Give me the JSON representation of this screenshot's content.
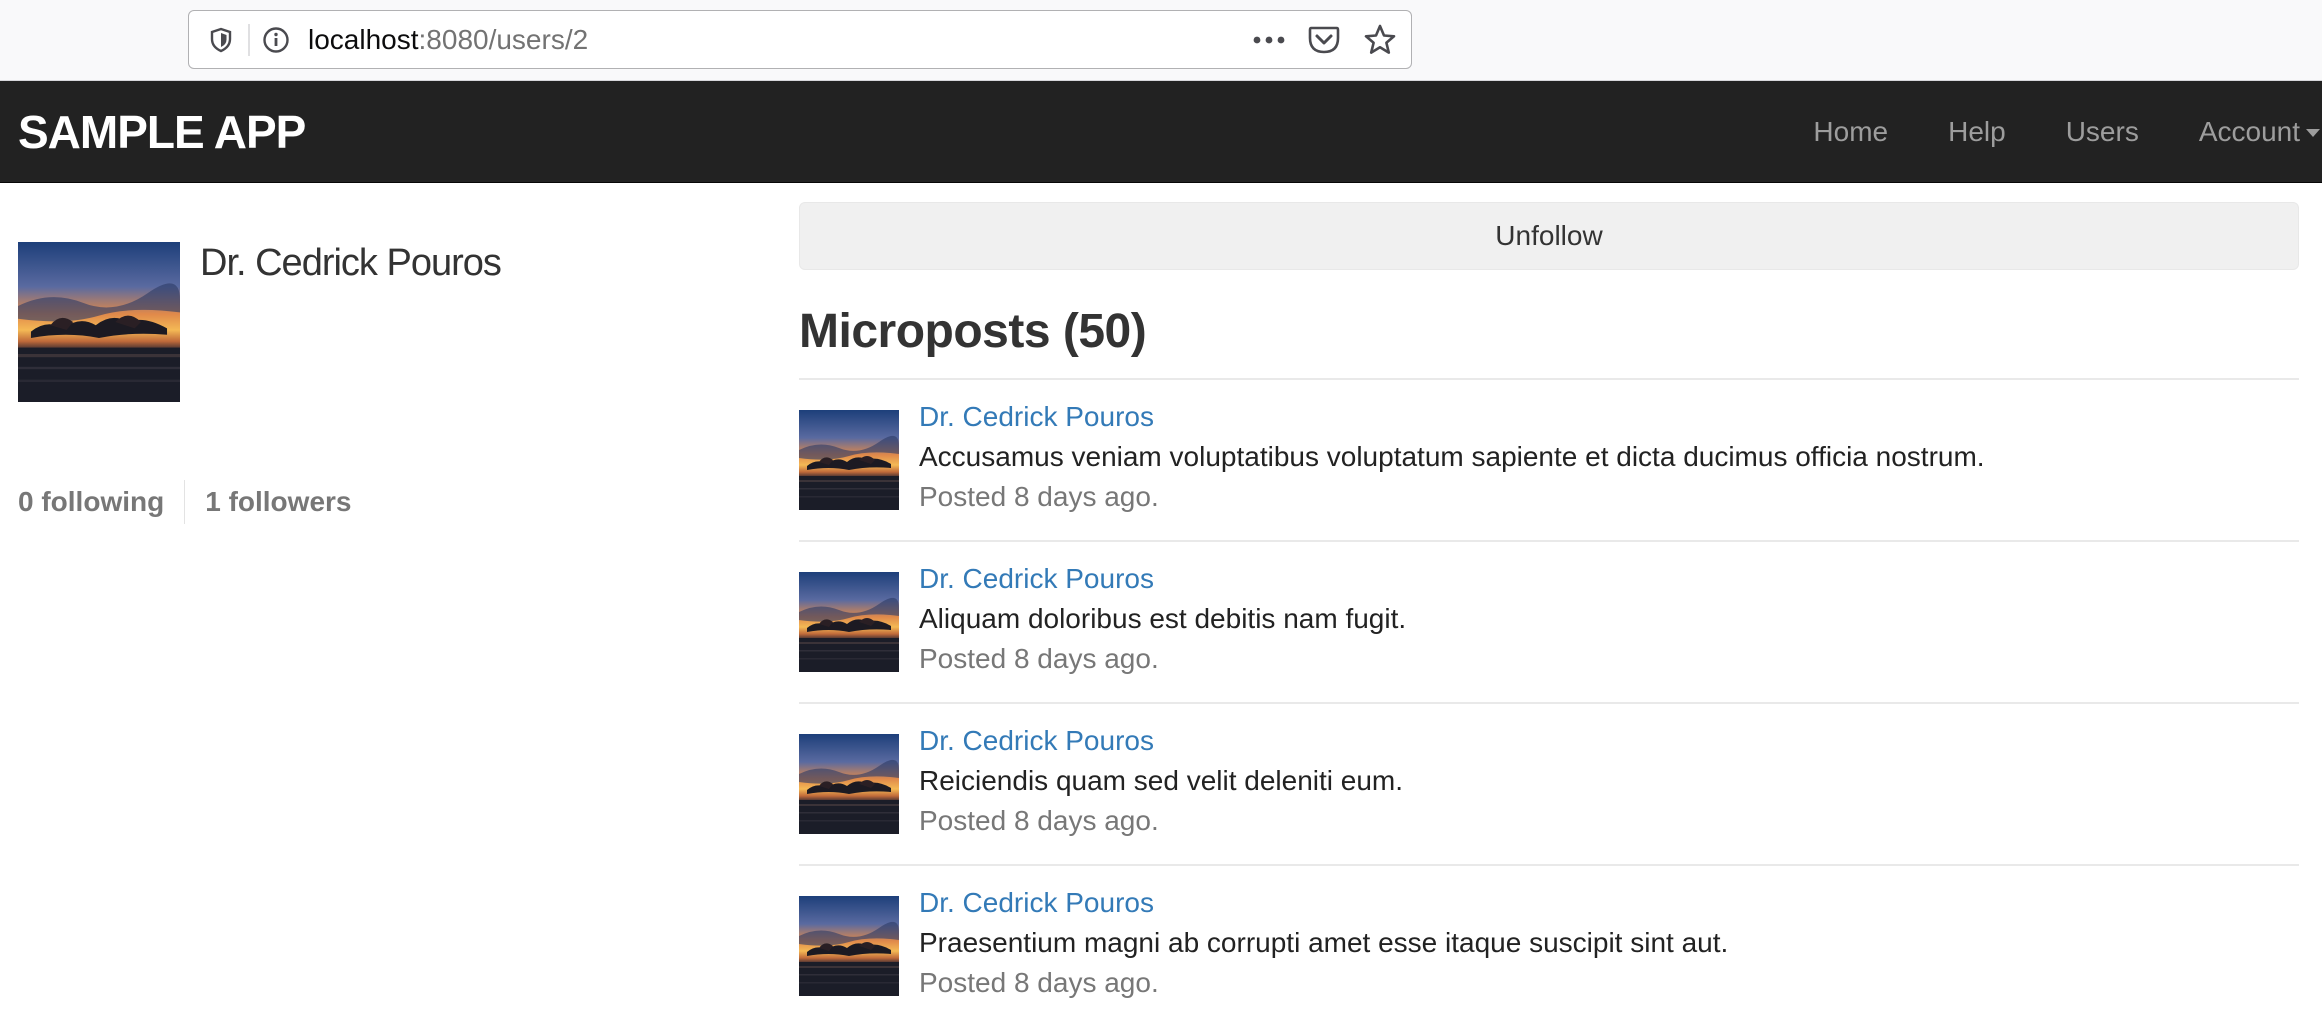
{
  "browser": {
    "url_host": "localhost",
    "url_path": ":8080/users/2"
  },
  "navbar": {
    "logo": "SAMPLE APP",
    "links": [
      "Home",
      "Help",
      "Users",
      "Account"
    ]
  },
  "user": {
    "name": "Dr. Cedrick Pouros",
    "following": "0 following",
    "followers": "1 followers"
  },
  "actions": {
    "unfollow_label": "Unfollow"
  },
  "microposts": {
    "title": "Microposts (50)",
    "items": [
      {
        "author": "Dr. Cedrick Pouros",
        "content": "Accusamus veniam voluptatibus voluptatum sapiente et dicta ducimus officia nostrum.",
        "timestamp": "Posted 8 days ago."
      },
      {
        "author": "Dr. Cedrick Pouros",
        "content": "Aliquam doloribus est debitis nam fugit.",
        "timestamp": "Posted 8 days ago."
      },
      {
        "author": "Dr. Cedrick Pouros",
        "content": "Reiciendis quam sed velit deleniti eum.",
        "timestamp": "Posted 8 days ago."
      },
      {
        "author": "Dr. Cedrick Pouros",
        "content": "Praesentium magni ab corrupti amet esse itaque suscipit sint aut.",
        "timestamp": "Posted 8 days ago."
      }
    ]
  },
  "icons": {
    "tracking_protection": "shield-icon",
    "site_info": "info-icon",
    "page_actions": "more-dots-icon",
    "pocket": "pocket-icon",
    "bookmark": "star-icon",
    "dropdown": "caret-down-icon",
    "avatar": "sunset-avatar-image"
  },
  "colors": {
    "navbar_bg": "#222222",
    "link_blue": "#337ab7",
    "muted_gray": "#777777"
  }
}
